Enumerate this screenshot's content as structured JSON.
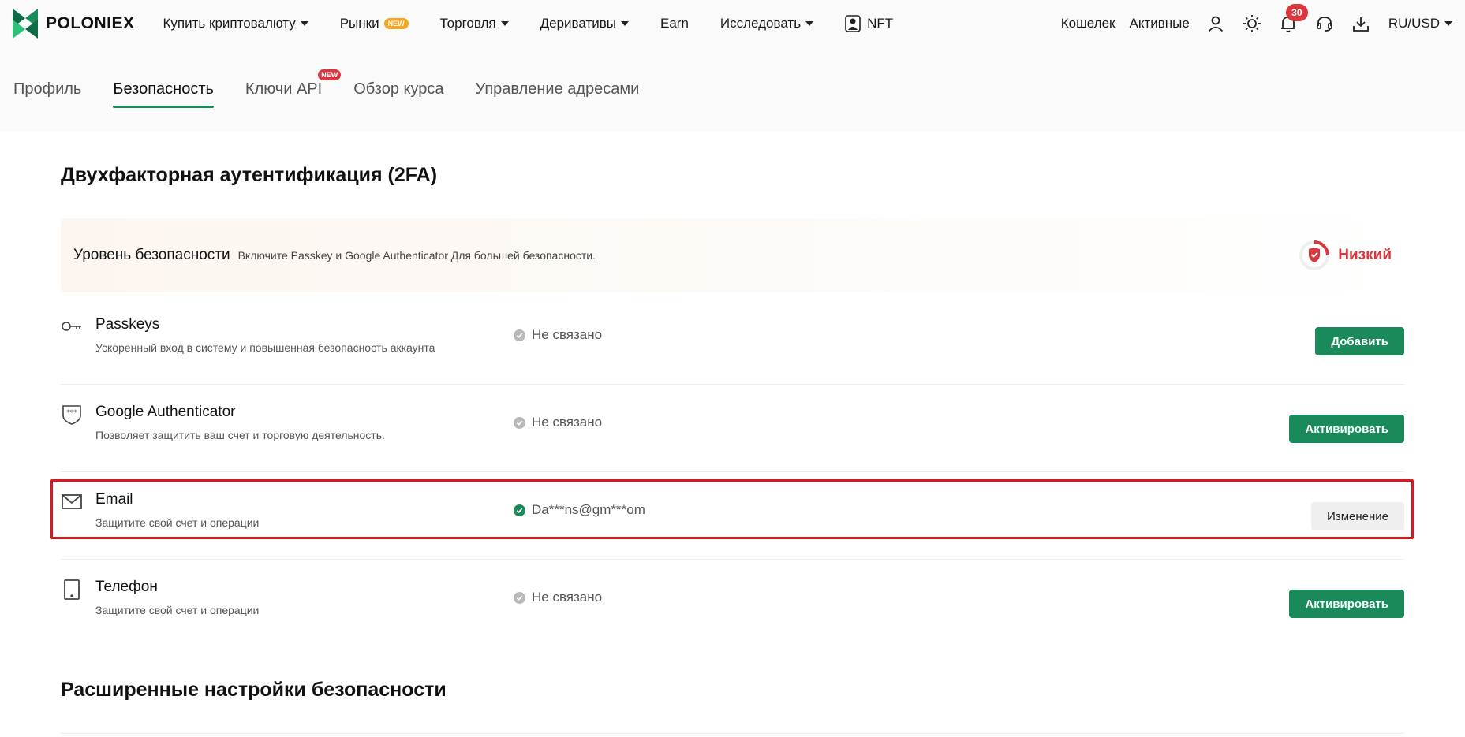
{
  "header": {
    "brand": "POLONIEX",
    "nav": [
      {
        "label": "Купить криптовалюту",
        "caret": true
      },
      {
        "label": "Рынки",
        "badge": "NEW"
      },
      {
        "label": "Торговля",
        "caret": true
      },
      {
        "label": "Деривативы",
        "caret": true
      },
      {
        "label": "Earn"
      },
      {
        "label": "Исследовать",
        "caret": true
      },
      {
        "label": "NFT"
      }
    ],
    "wallet": "Кошелек",
    "assets": "Активные",
    "notifications_count": "30",
    "locale": "RU/USD",
    "icons": [
      "user-icon",
      "theme-sun-icon",
      "bell-icon",
      "support-headset-icon",
      "download-icon"
    ]
  },
  "tabs": [
    {
      "label": "Профиль"
    },
    {
      "label": "Безопасность",
      "active": true
    },
    {
      "label": "Ключи API",
      "badge": "NEW"
    },
    {
      "label": "Обзор курса"
    },
    {
      "label": "Управление адресами"
    }
  ],
  "twofa": {
    "title": "Двухфакторная аутентификация (2FA)",
    "level": {
      "label": "Уровень безопасности",
      "hint": "Включите Passkey и Google Authenticator Для большей безопасности.",
      "status": "Низкий",
      "status_color": "#d9363e"
    },
    "items": [
      {
        "name": "Passkeys",
        "desc": "Ускоренный вход в систему и повышенная безопасность аккаунта",
        "status": "Не связано",
        "linked": false,
        "button": "Добавить",
        "icon": "key-icon"
      },
      {
        "name": "Google Authenticator",
        "desc": "Позволяет защитить ваш счет и торговую деятельность.",
        "status": "Не связано",
        "linked": false,
        "button": "Активировать",
        "icon": "authenticator-shield-icon"
      },
      {
        "name": "Email",
        "desc": "Защитите свой счет и операции",
        "status": "Da***ns@gm***om",
        "linked": true,
        "button": "Изменение",
        "icon": "envelope-icon"
      },
      {
        "name": "Телефон",
        "desc": "Защитите свой счет и операции",
        "status": "Не связано",
        "linked": false,
        "button": "Активировать",
        "icon": "phone-icon"
      }
    ]
  },
  "advanced": {
    "title": "Расширенные настройки безопасности"
  },
  "colors": {
    "accent": "#1a8a5a",
    "danger": "#d9363e",
    "highlight": "#d71920"
  }
}
